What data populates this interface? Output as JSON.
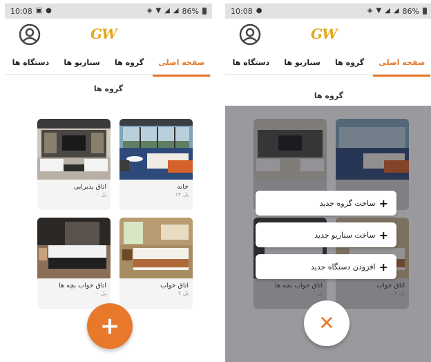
{
  "status": {
    "time": "10:08",
    "battery": "86%"
  },
  "logo": "GW",
  "tabs": [
    {
      "label": "صفحه اصلی",
      "active": true
    },
    {
      "label": "گروه ها",
      "active": false
    },
    {
      "label": "سناریو ها",
      "active": false
    },
    {
      "label": "دستگاه ها",
      "active": false
    }
  ],
  "section_title": "گروه ها",
  "groups": [
    {
      "name": "خانه",
      "count": "۱۴ پل"
    },
    {
      "name": "اتاق پذیرایی",
      "count": "۰ پل"
    },
    {
      "name": "اتاق خواب",
      "count": "۷ پل"
    },
    {
      "name": "اتاق خواب بچه ها",
      "count": "۰ پل"
    }
  ],
  "fab": {
    "open_icon": "+",
    "close_icon": "✕"
  },
  "menu": [
    {
      "label": "ساخت گروه جدید"
    },
    {
      "label": "ساخت سناریو جدید"
    },
    {
      "label": "افزودن دستگاه جدید"
    }
  ],
  "colors": {
    "accent": "#e8782a",
    "logo": "#e0a91e"
  }
}
